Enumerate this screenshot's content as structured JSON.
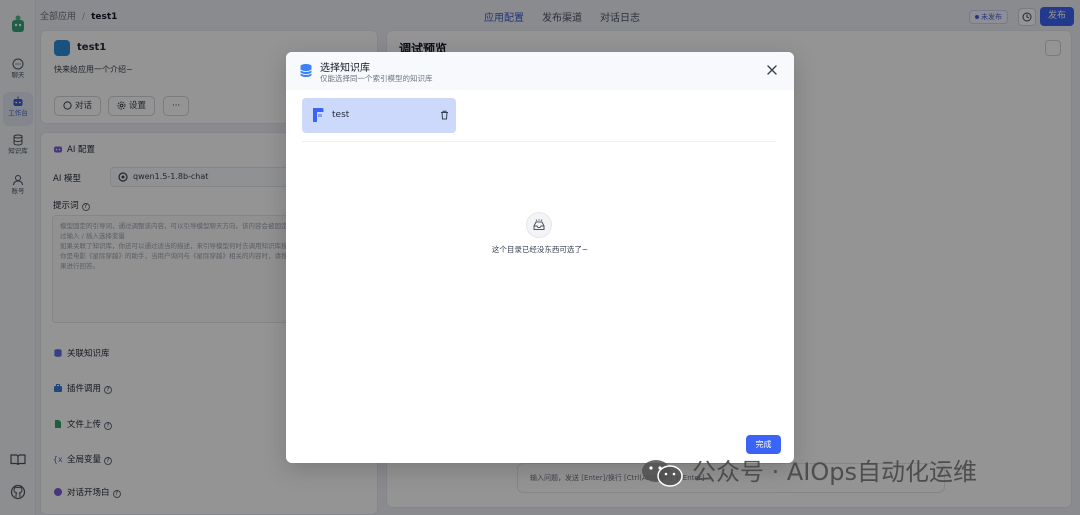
{
  "rail": {
    "items": [
      {
        "label": "聊天"
      },
      {
        "label": "工作台"
      },
      {
        "label": "知识库"
      },
      {
        "label": "账号"
      }
    ]
  },
  "header": {
    "breadcrumb_root": "全部应用",
    "breadcrumb_sep": "/",
    "breadcrumb_current": "test1",
    "tabs": [
      {
        "label": "应用配置",
        "active": true
      },
      {
        "label": "发布渠道",
        "active": false
      },
      {
        "label": "对话日志",
        "active": false
      }
    ],
    "status": "未发布",
    "publish_label": "发布"
  },
  "app": {
    "name": "test1",
    "intro": "快来给应用一个介绍~",
    "chat_btn": "对话",
    "settings_btn": "设置",
    "more_btn": "···"
  },
  "ai_config": {
    "title": "AI 配置",
    "model_label": "AI 模型",
    "model_value": "qwen1.5-1.8b-chat",
    "prompt_label": "提示词",
    "prompt_text": "模型固定的引导词，通过调整该内容，可以引导模型聊天方向。该内容会被固定在上下文的开头。可通过输入 / 插入选择变量\n如果关联了知识库，你还可以通过适当的描述，来引导模型何时去调用知识库搜索。例如：\n你是电影《星际穿越》的助手，当用户询问与《星际穿越》相关的内容时，请搜索知识库并结合搜索结果进行回答。"
  },
  "sections": [
    {
      "title": "关联知识库",
      "help": false
    },
    {
      "title": "插件调用",
      "help": true
    },
    {
      "title": "文件上传",
      "help": true
    },
    {
      "title": "全局变量",
      "help": true
    },
    {
      "title": "对话开场白",
      "help": true
    }
  ],
  "debug": {
    "title": "调试预览",
    "input_placeholder": "输入问题，发送 [Enter]/换行 [Ctrl(Alt/Shift) + Enter]"
  },
  "modal": {
    "title": "选择知识库",
    "subtitle": "仅能选择同一个索引模型的知识库",
    "items": [
      {
        "name": "test"
      }
    ],
    "empty_text": "这个目录已经没东西可选了~",
    "done_label": "完成"
  },
  "watermark": {
    "text": "公众号 · AIOps自动化运维"
  },
  "colors": {
    "accent": "#3b63f5",
    "selected_item": "#cdd9fb"
  }
}
